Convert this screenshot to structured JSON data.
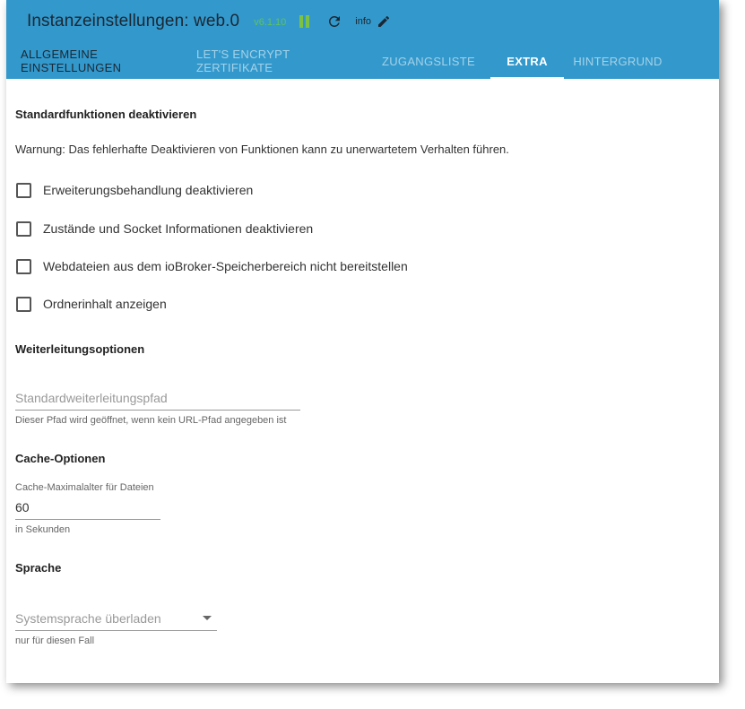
{
  "header": {
    "title": "Instanzeinstellungen: web.0",
    "version": "v6.1.10",
    "info_label": "info"
  },
  "tabs": [
    {
      "label": "Allgemeine Einstellungen",
      "active": false
    },
    {
      "label": "Let's Encrypt Zertifikate",
      "active": false
    },
    {
      "label": "Zugangsliste",
      "active": false
    },
    {
      "label": "Extra",
      "active": true
    },
    {
      "label": "Hintergrund",
      "active": false
    }
  ],
  "standard": {
    "title": "Standardfunktionen deaktivieren",
    "warning": "Warnung: Das fehlerhafte Deaktivieren von Funktionen kann zu unerwartetem Verhalten führen.",
    "checkboxes": [
      {
        "label": "Erweiterungsbehandlung deaktivieren",
        "checked": false
      },
      {
        "label": "Zustände und Socket Informationen deaktivieren",
        "checked": false
      },
      {
        "label": "Webdateien aus dem ioBroker-Speicherbereich nicht bereitstellen",
        "checked": false
      },
      {
        "label": "Ordnerinhalt anzeigen",
        "checked": false
      }
    ]
  },
  "redirect": {
    "title": "Weiterleitungsoptionen",
    "placeholder": "Standardweiterleitungspfad",
    "value": "",
    "helper": "Dieser Pfad wird geöffnet, wenn kein URL-Pfad angegeben ist"
  },
  "cache": {
    "title": "Cache-Optionen",
    "label": "Cache-Maximalalter für Dateien",
    "value": "60",
    "helper": "in Sekunden"
  },
  "language": {
    "title": "Sprache",
    "placeholder": "Systemsprache überladen",
    "helper": "nur für diesen Fall"
  },
  "colors": {
    "header_bg": "#3399cc",
    "active_tab": "#ffffff",
    "pause_icon": "#7dc243",
    "version_text": "#5ec25e"
  },
  "icons": [
    "pause-icon",
    "refresh-icon",
    "edit-icon",
    "dropdown-icon"
  ]
}
